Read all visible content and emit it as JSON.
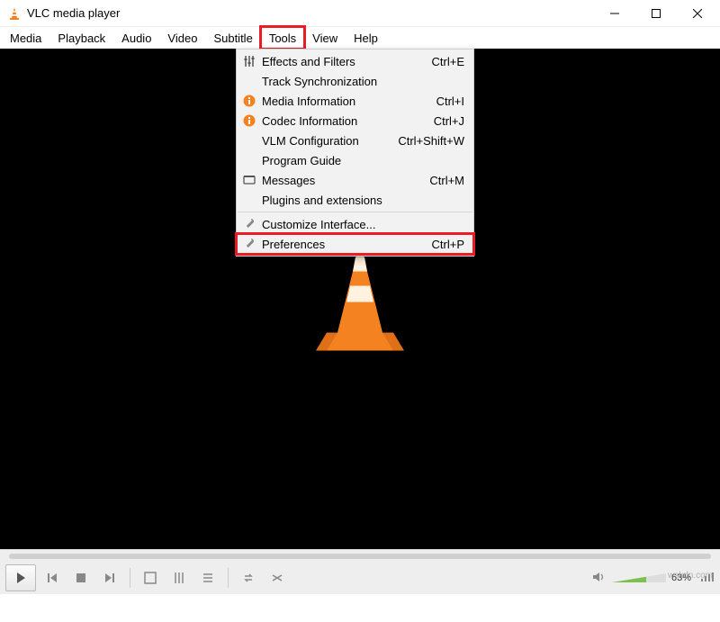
{
  "window": {
    "title": "VLC media player"
  },
  "menubar": {
    "items": [
      {
        "label": "Media"
      },
      {
        "label": "Playback"
      },
      {
        "label": "Audio"
      },
      {
        "label": "Video"
      },
      {
        "label": "Subtitle"
      },
      {
        "label": "Tools"
      },
      {
        "label": "View"
      },
      {
        "label": "Help"
      }
    ]
  },
  "tools_menu": {
    "items": [
      {
        "label": "Effects and Filters",
        "shortcut": "Ctrl+E",
        "icon": "sliders"
      },
      {
        "label": "Track Synchronization",
        "shortcut": "",
        "icon": ""
      },
      {
        "label": "Media Information",
        "shortcut": "Ctrl+I",
        "icon": "info"
      },
      {
        "label": "Codec Information",
        "shortcut": "Ctrl+J",
        "icon": "info"
      },
      {
        "label": "VLM Configuration",
        "shortcut": "Ctrl+Shift+W",
        "icon": ""
      },
      {
        "label": "Program Guide",
        "shortcut": "",
        "icon": ""
      },
      {
        "label": "Messages",
        "shortcut": "Ctrl+M",
        "icon": "messages"
      },
      {
        "label": "Plugins and extensions",
        "shortcut": "",
        "icon": ""
      },
      {
        "label": "Customize Interface...",
        "shortcut": "",
        "icon": "wrench"
      },
      {
        "label": "Preferences",
        "shortcut": "Ctrl+P",
        "icon": "wrench"
      }
    ]
  },
  "status": {
    "volume_percent": "63%"
  },
  "watermark": "wskdn.com"
}
